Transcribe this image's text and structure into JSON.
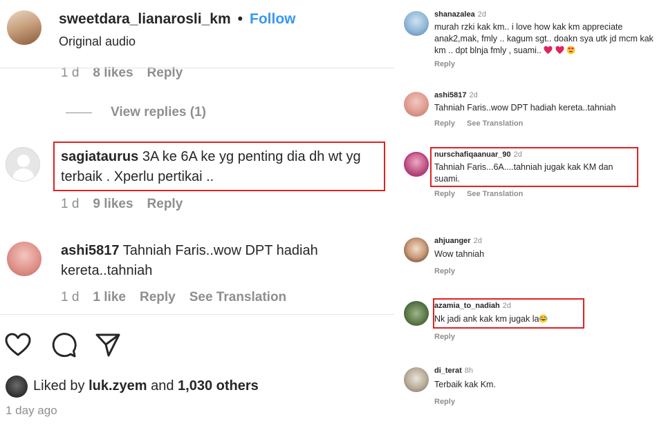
{
  "left": {
    "header": {
      "username": "sweetdara_lianarosli_km",
      "dot": "•",
      "follow": "Follow",
      "audio": "Original audio"
    },
    "prev_meta": {
      "time": "1 d",
      "likes": "8 likes",
      "reply": "Reply"
    },
    "view_replies": "View replies (1)",
    "comments": [
      {
        "username": "sagiataurus",
        "text": "3A ke 6A ke yg penting dia dh wt yg terbaik . Xperlu pertikai ..",
        "time": "1 d",
        "likes": "9 likes",
        "reply": "Reply",
        "highlighted": true
      },
      {
        "username": "ashi5817",
        "text": "Tahniah Faris..wow DPT hadiah kereta..tahniah",
        "time": "1 d",
        "likes": "1 like",
        "reply": "Reply",
        "translate": "See Translation"
      }
    ],
    "actions": {
      "like_icon": "heart-icon",
      "comment_icon": "comment-icon",
      "share_icon": "paper-plane-icon"
    },
    "liked_by": {
      "prefix": "Liked by",
      "user": "luk.zyem",
      "conj": "and",
      "others": "1,030 others"
    },
    "time_ago": "1 day ago"
  },
  "right": {
    "comments": [
      {
        "username": "shanazalea",
        "time": "2d",
        "text": "murah rzki kak km.. i love how kak km appreciate anak2,mak, fmly .. kagum sgt.. doakn sya utk jd mcm kak km .. dpt blnja fmly , suami..",
        "emoji": [
          "red-heart",
          "red-heart",
          "heart-eyes-face"
        ],
        "reply": "Reply"
      },
      {
        "username": "ashi5817",
        "time": "2d",
        "text": "Tahniah Faris..wow DPT hadiah kereta..tahniah",
        "reply": "Reply",
        "translate": "See Translation"
      },
      {
        "username": "nurschafiqaanuar_90",
        "time": "2d",
        "text": "Tahniah Faris...6A....tahniah jugak kak KM dan suami.",
        "reply": "Reply",
        "translate": "See Translation",
        "highlighted": true
      },
      {
        "username": "ahjuanger",
        "time": "2d",
        "text": "Wow tahniah",
        "reply": "Reply"
      },
      {
        "username": "azamia_to_nadiah",
        "time": "2d",
        "text": "Nk jadi ank kak km jugak la",
        "emoji": [
          "tears-of-joy-face"
        ],
        "reply": "Reply",
        "highlighted": true
      },
      {
        "username": "di_terat",
        "time": "8h",
        "text": "Terbaik kak Km.",
        "reply": "Reply"
      }
    ]
  },
  "colors": {
    "accent": "#3897f0",
    "highlight": "#e02020",
    "muted": "#8e8e8e"
  }
}
